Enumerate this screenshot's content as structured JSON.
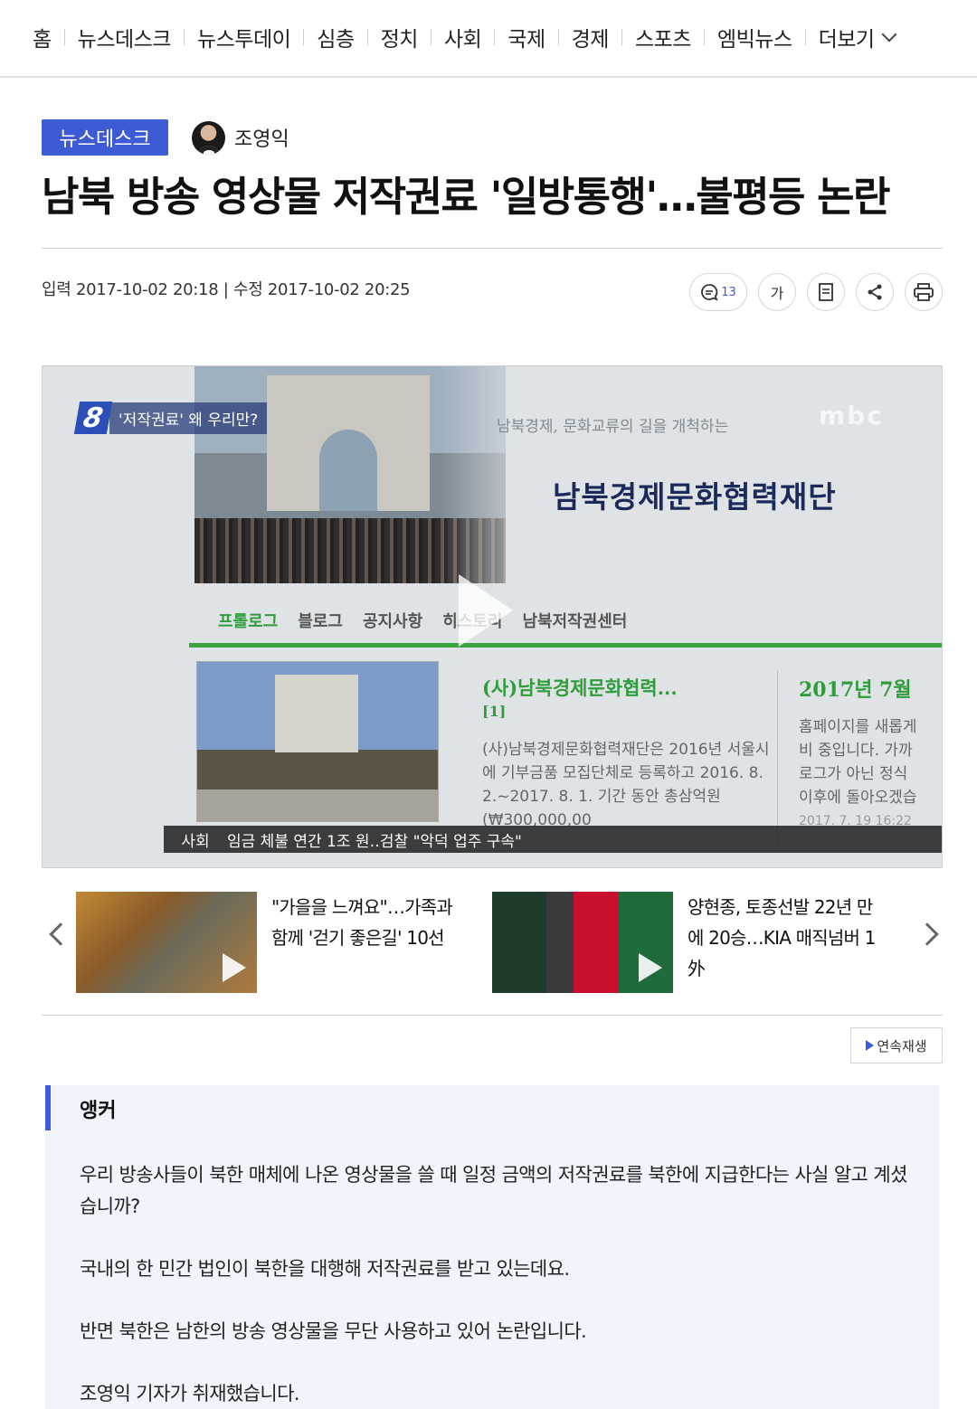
{
  "nav": {
    "items": [
      "홈",
      "뉴스데스크",
      "뉴스투데이",
      "심층",
      "정치",
      "사회",
      "국제",
      "경제",
      "스포츠",
      "엠빅뉴스",
      "더보기"
    ]
  },
  "article": {
    "program_badge": "뉴스데스크",
    "reporter": "조영익",
    "headline": "남북 방송 영상물 저작권료 '일방통행'…불평등 논란",
    "dates": "입력 2017-10-02 20:18 | 수정 2017-10-02 20:25",
    "comment_count": "13",
    "font_size_label": "가"
  },
  "video": {
    "logo_number": "8",
    "caption": "'저작권료' 왜 우리만?",
    "top_line": "남북경제, 문화교류의 길을 개척하는",
    "broadcaster_watermark": "mbc",
    "site_name": "남북경제문화협력재단",
    "menu": [
      "프롤로그",
      "블로그",
      "공지사항",
      "히스토리",
      "남북저작권센터"
    ],
    "col2_title": "(사)남북경제문화협력...",
    "col2_tag": "[1]",
    "col2_text": "(사)남북경제문화협력재단은 2016년 서울시에 기부금품 모집단체로 등록하고 2016. 8. 2.~2017. 8. 1. 기간 동안 총삼억원(₩300,000,00",
    "col3_title": "2017년 7월",
    "col3_text": [
      "홈페이지를 새롭게",
      "비 중입니다. 가까",
      "로그가 아닌 정식",
      "이후에 돌아오겠습"
    ],
    "col3_date": "2017. 7. 19 16:22",
    "ticker_section": "사회",
    "ticker_text": "임금 체불 연간 1조 원‥검찰 \"악덕 업주 구속\""
  },
  "related": [
    {
      "title": "\"가을을 느껴요\"…가족과 함께 '걷기 좋은길' 10선"
    },
    {
      "title": "양현종, 토종선발 22년 만에 20승…KIA 매직넘버 1外"
    }
  ],
  "autoplay_label": "연속재생",
  "body": {
    "anchor_label": "앵커",
    "paragraphs": [
      "우리 방송사들이 북한 매체에 나온 영상물을 쓸 때 일정 금액의 저작권료를 북한에 지급한다는 사실 알고 계셨습니까?",
      "국내의 한 민간 법인이 북한을 대행해 저작권료를 받고 있는데요.",
      "반면 북한은 남한의 방송 영상물을 무단 사용하고 있어 논란입니다.",
      "조영익 기자가 취재했습니다."
    ]
  },
  "colors": {
    "accent": "#3e5bd6",
    "green": "#3aa33f"
  },
  "icons": [
    "comment-icon",
    "font-size-icon",
    "bookmark-icon",
    "share-icon",
    "print-icon",
    "play-icon",
    "chevron-left-icon",
    "chevron-right-icon"
  ]
}
